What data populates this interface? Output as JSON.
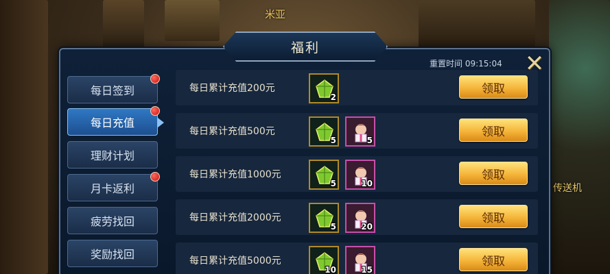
{
  "scene": {
    "npc_name": "米亚",
    "teleport_label": "传送机"
  },
  "panel": {
    "title": "福利",
    "reset_time": "重置时间 09:15:04"
  },
  "tabs": [
    {
      "label": "每日签到",
      "active": false,
      "badge": true
    },
    {
      "label": "每日充值",
      "active": true,
      "badge": true
    },
    {
      "label": "理财计划",
      "active": false,
      "badge": false
    },
    {
      "label": "月卡返利",
      "active": false,
      "badge": true
    },
    {
      "label": "疲劳找回",
      "active": false,
      "badge": false
    },
    {
      "label": "奖励找回",
      "active": false,
      "badge": false
    }
  ],
  "rewards": [
    {
      "label": "每日累计充值200元",
      "items": [
        {
          "type": "green-gem-icon",
          "qty": "2"
        }
      ],
      "button": "领取"
    },
    {
      "label": "每日累计充值500元",
      "items": [
        {
          "type": "green-gem-icon",
          "qty": "5"
        },
        {
          "type": "pink-gift-icon",
          "qty": "5"
        }
      ],
      "button": "领取"
    },
    {
      "label": "每日累计充值1000元",
      "items": [
        {
          "type": "green-gem-icon",
          "qty": "5"
        },
        {
          "type": "pink-gift-icon",
          "qty": "10"
        }
      ],
      "button": "领取"
    },
    {
      "label": "每日累计充值2000元",
      "items": [
        {
          "type": "green-gem-icon",
          "qty": "5"
        },
        {
          "type": "pink-gift-icon",
          "qty": "20"
        }
      ],
      "button": "领取"
    },
    {
      "label": "每日累计充值5000元",
      "items": [
        {
          "type": "green-gem-icon",
          "qty": "10"
        },
        {
          "type": "pink-gift-icon",
          "qty": "15"
        }
      ],
      "button": "领取"
    }
  ],
  "colors": {
    "claim_button": "#f5b53a",
    "active_tab": "#2f78c4",
    "panel_bg": "#0f2138"
  }
}
